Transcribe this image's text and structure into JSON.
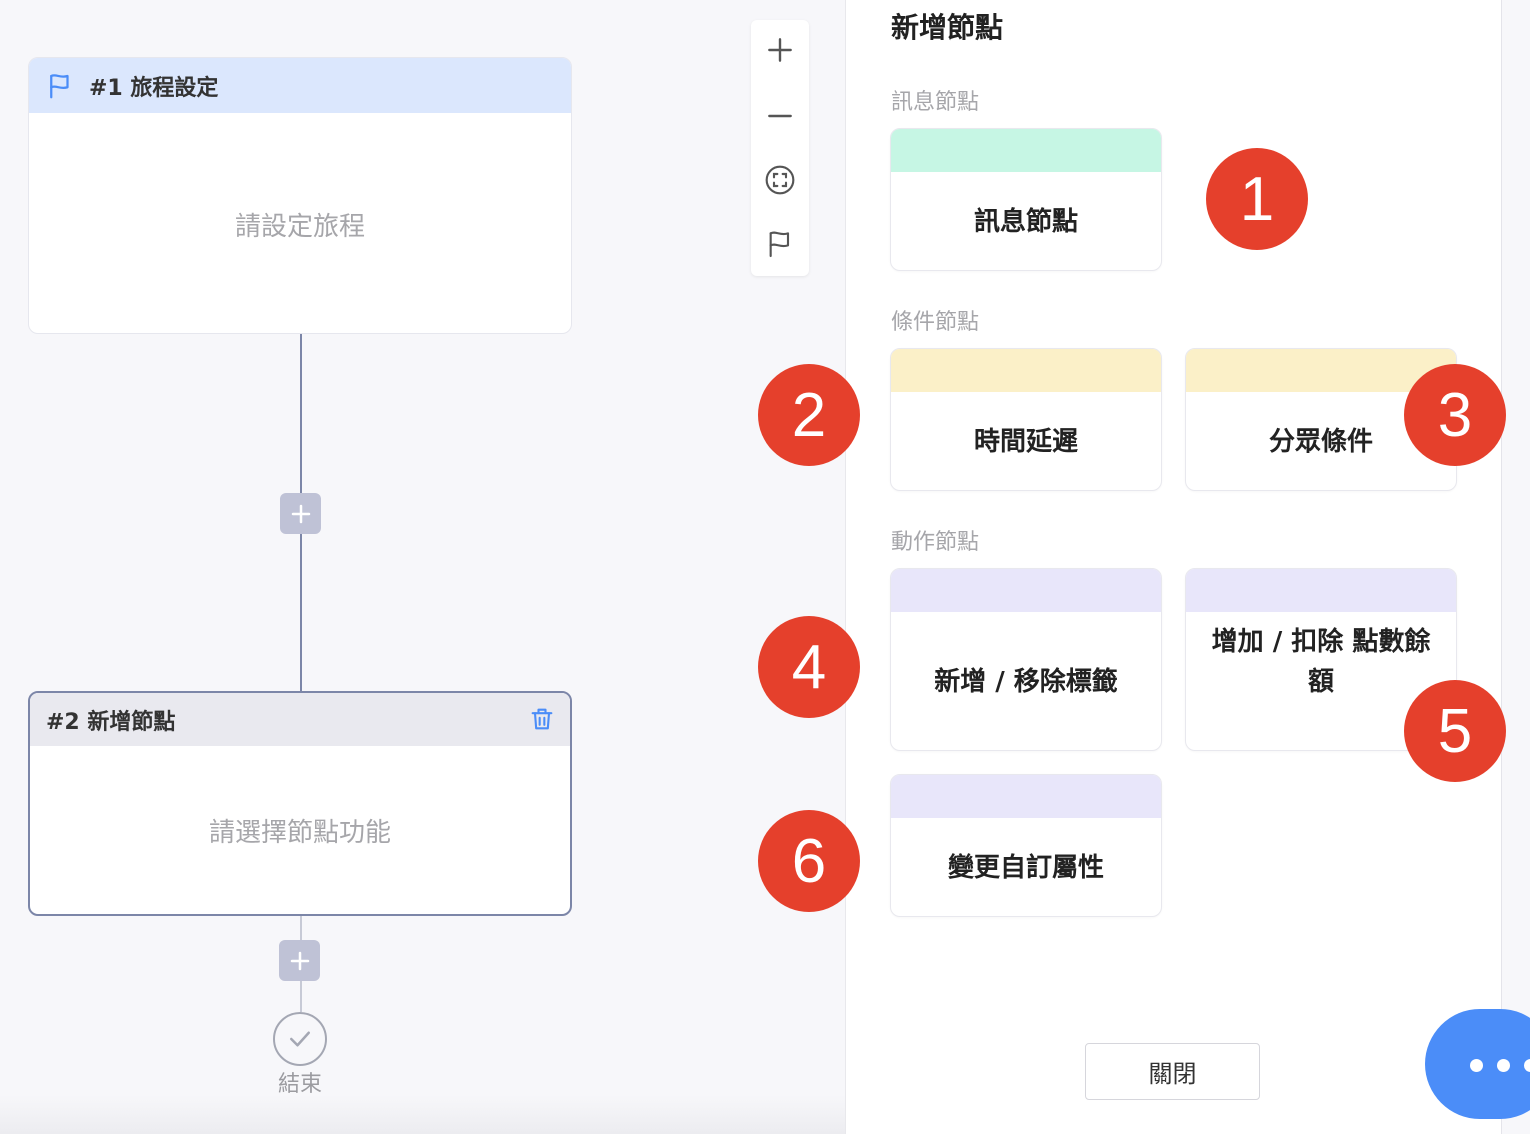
{
  "canvas": {
    "node1": {
      "title": "#1 旅程設定",
      "placeholder": "請設定旅程"
    },
    "node2": {
      "title": "#2 新增節點",
      "placeholder": "請選擇節點功能"
    },
    "end_label": "結束"
  },
  "toolbar": {
    "icons": [
      "zoom-in-icon",
      "zoom-out-icon",
      "fit-view-icon",
      "flag-icon"
    ]
  },
  "panel": {
    "title": "新增節點",
    "sections": {
      "message": {
        "label": "訊息節點",
        "cards": [
          "訊息節點"
        ]
      },
      "condition": {
        "label": "條件節點",
        "cards": [
          "時間延遲",
          "分眾條件"
        ]
      },
      "action": {
        "label": "動作節點",
        "cards": [
          "新增 / 移除標籤",
          "增加 / 扣除 點數餘額",
          "變更自訂屬性"
        ]
      }
    },
    "close_label": "關閉"
  },
  "badges": [
    "1",
    "2",
    "3",
    "4",
    "5",
    "6"
  ],
  "colors": {
    "message_strip": "#c6f6e4",
    "condition_strip": "#fbf0c8",
    "action_strip": "#e8e6fa",
    "badge": "#e5402c",
    "chat_button": "#4b8df8",
    "node_header_active": "#dbe7fd"
  }
}
